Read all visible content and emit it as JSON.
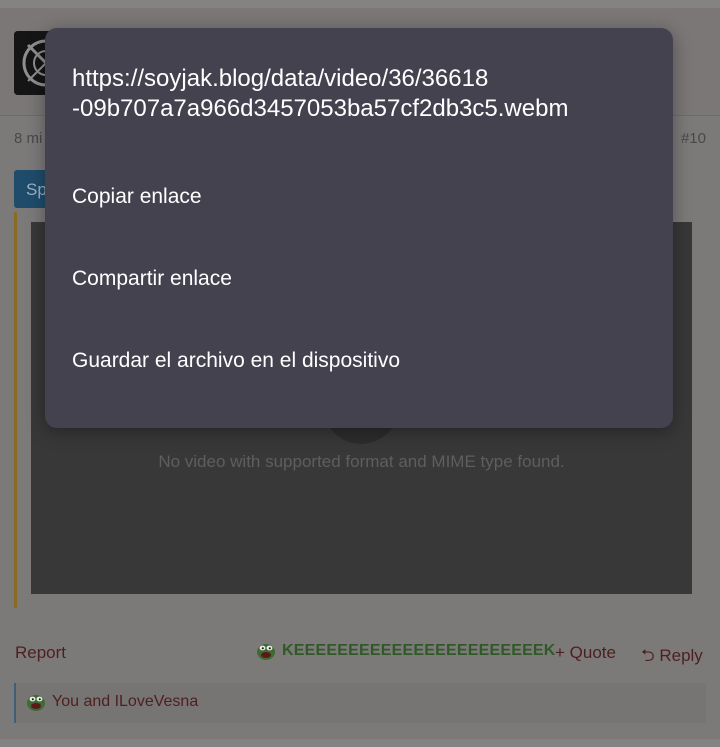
{
  "post": {
    "meta_left": "8 mi",
    "meta_right": "#10",
    "spoiler_label": "Sp",
    "video_message": "No video with supported format and MIME type found.",
    "report_label": "Report",
    "reaction_label": "KEEEEEEEEEEEEEEEEEEEEEEEK",
    "quote_label": "+ Quote",
    "reply_label": "Reply",
    "reacted_by": "You and ILoveVesna"
  },
  "context_menu": {
    "url_line1": "https://soyjak.blog/data/video/36/36618",
    "url_line2": "-09b707a7a966d3457053ba57cf2db3c5.webm",
    "items": [
      {
        "label": "Copiar enlace"
      },
      {
        "label": "Compartir enlace"
      },
      {
        "label": "Guardar el archivo en el dispositivo"
      }
    ]
  },
  "colors": {
    "menu_bg": "#44424f",
    "reaction_green": "#2f5a27",
    "link_red": "#4e1f1f"
  }
}
